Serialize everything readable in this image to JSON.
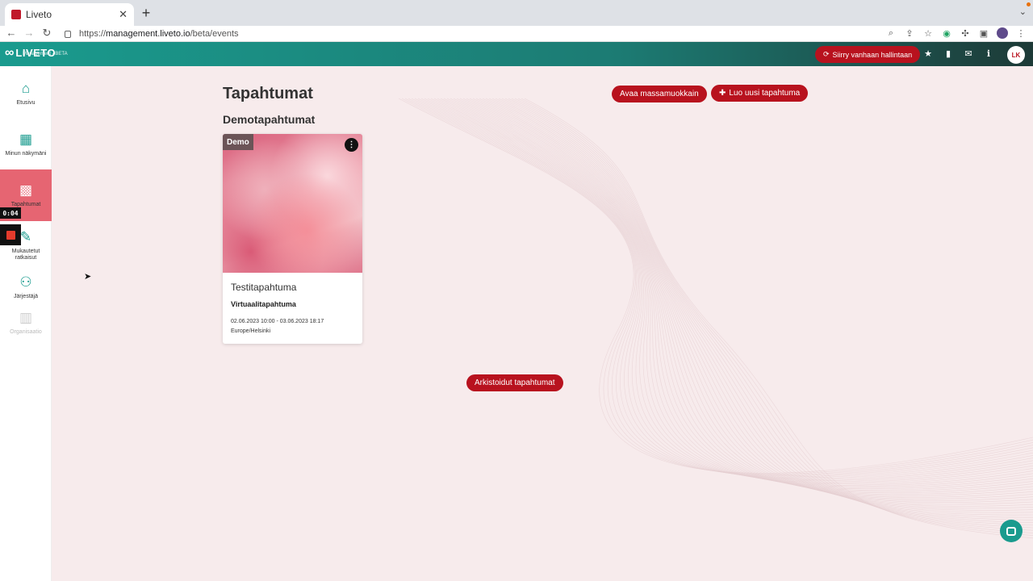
{
  "browser": {
    "tab_title": "Liveto",
    "tab_close": "✕",
    "new_tab": "+",
    "url_scheme": "https://",
    "url_host": "management.liveto.io",
    "url_path": "/beta/events"
  },
  "header": {
    "logo_text": "LIVETO",
    "logo_sub": "Management - BETA",
    "old_admin_button": "Siirry vanhaan hallintaan",
    "avatar_initials": "LK"
  },
  "sidebar": {
    "items": [
      {
        "label": "Etusivu",
        "icon": "home-icon"
      },
      {
        "label": "Minun näkymäni",
        "icon": "layout-icon"
      },
      {
        "label": "Tapahtumat",
        "icon": "calendar-icon"
      },
      {
        "label": "Mukautetut ratkaisut",
        "icon": "edit-icon"
      },
      {
        "label": "Järjestäjä",
        "icon": "users-icon"
      },
      {
        "label": "Organisaatio",
        "icon": "building-icon"
      }
    ],
    "recording_time": "0:04"
  },
  "main": {
    "title": "Tapahtumat",
    "bulk_edit_button": "Avaa massamuokkain",
    "new_event_button": "Luo uusi tapahtuma",
    "section_title": "Demotapahtumat",
    "card": {
      "badge": "Demo",
      "name": "Testitapahtuma",
      "type": "Virtuaalitapahtuma",
      "dates": "02.06.2023 10:00 - 03.06.2023 18:17",
      "timezone": "Europe/Helsinki"
    },
    "archived_button": "Arkistoidut tapahtumat"
  },
  "colors": {
    "accent": "#b8121e",
    "brand_teal": "#1a9b8e",
    "active_nav": "#e66572",
    "background": "#f7ebec"
  }
}
